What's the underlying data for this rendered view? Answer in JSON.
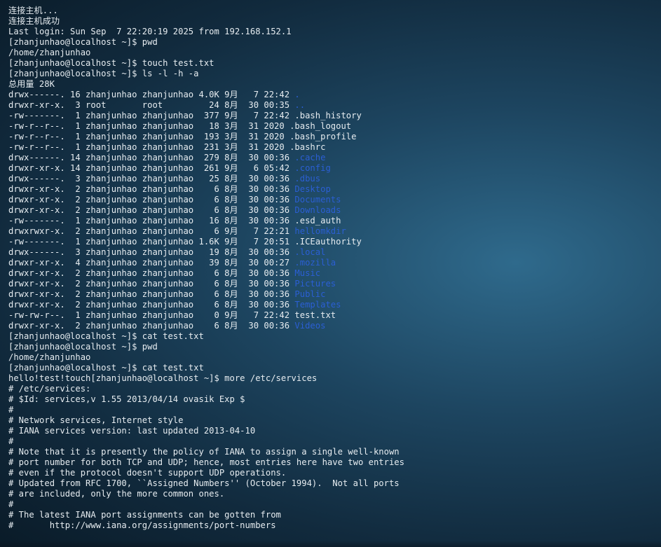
{
  "terminal": {
    "lines": [
      {
        "text": "连接主机..."
      },
      {
        "text": "连接主机成功"
      },
      {
        "text": "Last login: Sun Sep  7 22:20:19 2025 from 192.168.152.1"
      },
      {
        "text": "[zhanjunhao@localhost ~]$ pwd"
      },
      {
        "text": "/home/zhanjunhao"
      },
      {
        "text": "[zhanjunhao@localhost ~]$ touch test.txt"
      },
      {
        "text": "[zhanjunhao@localhost ~]$ ls -l -h -a"
      },
      {
        "text": "总用量 28K"
      },
      {
        "text": "drwx------. 16 zhanjunhao zhanjunhao 4.0K 9月   7 22:42 ",
        "name": ".",
        "dir": true
      },
      {
        "text": "drwxr-xr-x.  3 root       root         24 8月  30 00:35 ",
        "name": "..",
        "dir": true
      },
      {
        "text": "-rw-------.  1 zhanjunhao zhanjunhao  377 9月   7 22:42 ",
        "name": ".bash_history",
        "dir": false
      },
      {
        "text": "-rw-r--r--.  1 zhanjunhao zhanjunhao   18 3月  31 2020 ",
        "name": ".bash_logout",
        "dir": false
      },
      {
        "text": "-rw-r--r--.  1 zhanjunhao zhanjunhao  193 3月  31 2020 ",
        "name": ".bash_profile",
        "dir": false
      },
      {
        "text": "-rw-r--r--.  1 zhanjunhao zhanjunhao  231 3月  31 2020 ",
        "name": ".bashrc",
        "dir": false
      },
      {
        "text": "drwx------. 14 zhanjunhao zhanjunhao  279 8月  30 00:36 ",
        "name": ".cache",
        "dir": true
      },
      {
        "text": "drwxr-xr-x. 14 zhanjunhao zhanjunhao  261 9月   6 05:42 ",
        "name": ".config",
        "dir": true
      },
      {
        "text": "drwx------.  3 zhanjunhao zhanjunhao   25 8月  30 00:36 ",
        "name": ".dbus",
        "dir": true
      },
      {
        "text": "drwxr-xr-x.  2 zhanjunhao zhanjunhao    6 8月  30 00:36 ",
        "name": "Desktop",
        "dir": true
      },
      {
        "text": "drwxr-xr-x.  2 zhanjunhao zhanjunhao    6 8月  30 00:36 ",
        "name": "Documents",
        "dir": true
      },
      {
        "text": "drwxr-xr-x.  2 zhanjunhao zhanjunhao    6 8月  30 00:36 ",
        "name": "Downloads",
        "dir": true
      },
      {
        "text": "-rw-------.  1 zhanjunhao zhanjunhao   16 8月  30 00:36 ",
        "name": ".esd_auth",
        "dir": false
      },
      {
        "text": "drwxrwxr-x.  2 zhanjunhao zhanjunhao    6 9月   7 22:21 ",
        "name": "hellomkdir",
        "dir": true
      },
      {
        "text": "-rw-------.  1 zhanjunhao zhanjunhao 1.6K 9月   7 20:51 ",
        "name": ".ICEauthority",
        "dir": false
      },
      {
        "text": "drwx------.  3 zhanjunhao zhanjunhao   19 8月  30 00:36 ",
        "name": ".local",
        "dir": true
      },
      {
        "text": "drwxr-xr-x.  4 zhanjunhao zhanjunhao   39 8月  30 00:27 ",
        "name": ".mozilla",
        "dir": true
      },
      {
        "text": "drwxr-xr-x.  2 zhanjunhao zhanjunhao    6 8月  30 00:36 ",
        "name": "Music",
        "dir": true
      },
      {
        "text": "drwxr-xr-x.  2 zhanjunhao zhanjunhao    6 8月  30 00:36 ",
        "name": "Pictures",
        "dir": true
      },
      {
        "text": "drwxr-xr-x.  2 zhanjunhao zhanjunhao    6 8月  30 00:36 ",
        "name": "Public",
        "dir": true
      },
      {
        "text": "drwxr-xr-x.  2 zhanjunhao zhanjunhao    6 8月  30 00:36 ",
        "name": "Templates",
        "dir": true
      },
      {
        "text": "-rw-rw-r--.  1 zhanjunhao zhanjunhao    0 9月   7 22:42 ",
        "name": "test.txt",
        "dir": false
      },
      {
        "text": "drwxr-xr-x.  2 zhanjunhao zhanjunhao    6 8月  30 00:36 ",
        "name": "Videos",
        "dir": true
      },
      {
        "text": "[zhanjunhao@localhost ~]$ cat test.txt"
      },
      {
        "text": "[zhanjunhao@localhost ~]$ pwd"
      },
      {
        "text": "/home/zhanjunhao"
      },
      {
        "text": "[zhanjunhao@localhost ~]$ cat test.txt"
      },
      {
        "text": "hello!test!touch[zhanjunhao@localhost ~]$ more /etc/services"
      },
      {
        "text": "# /etc/services:"
      },
      {
        "text": "# $Id: services,v 1.55 2013/04/14 ovasik Exp $"
      },
      {
        "text": "#"
      },
      {
        "text": "# Network services, Internet style"
      },
      {
        "text": "# IANA services version: last updated 2013-04-10"
      },
      {
        "text": "#"
      },
      {
        "text": "# Note that it is presently the policy of IANA to assign a single well-known"
      },
      {
        "text": "# port number for both TCP and UDP; hence, most entries here have two entries"
      },
      {
        "text": "# even if the protocol doesn't support UDP operations."
      },
      {
        "text": "# Updated from RFC 1700, ``Assigned Numbers'' (October 1994).  Not all ports"
      },
      {
        "text": "# are included, only the more common ones."
      },
      {
        "text": "#"
      },
      {
        "text": "# The latest IANA port assignments can be gotten from"
      },
      {
        "text": "#       http://www.iana.org/assignments/port-numbers"
      }
    ]
  },
  "colors": {
    "text": "#e6ecf0",
    "directory": "#2b5fd4"
  }
}
